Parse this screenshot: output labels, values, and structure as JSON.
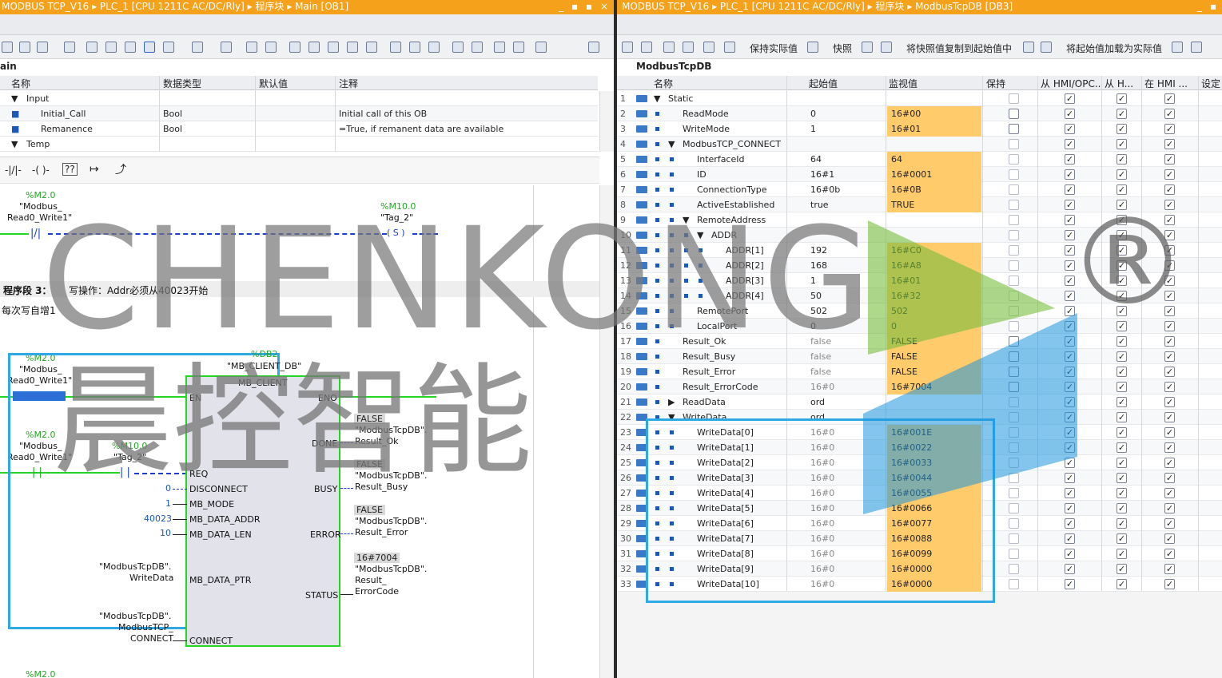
{
  "left_title": "MODBUS TCP_V16  ▸  PLC_1 [CPU 1211C AC/DC/Rly]  ▸  程序块  ▸  Main [OB1]",
  "right_title": "MODBUS TCP_V16  ▸  PLC_1 [CPU 1211C AC/DC/Rly]  ▸  程序块  ▸  ModbusTcpDB [DB3]",
  "window_controls": "_ ▪ ▪ ×",
  "interface": {
    "block_name": "ain",
    "headers": [
      "名称",
      "数据类型",
      "默认值",
      "注释"
    ],
    "rows": [
      {
        "name": "Input",
        "type": "",
        "default": "",
        "comment": ""
      },
      {
        "name": "Initial_Call",
        "type": "Bool",
        "default": "",
        "comment": "Initial call of this OB"
      },
      {
        "name": "Remanence",
        "type": "Bool",
        "default": "",
        "comment": "=True, if remanent data are available"
      },
      {
        "name": "Temp",
        "type": "",
        "default": "",
        "comment": ""
      }
    ]
  },
  "lad": {
    "net2": {
      "contact_addr": "%M2.0",
      "contact_tag1": "\"Modbus_",
      "contact_tag2": "Read0_Write1\"",
      "coil_addr": "%M10.0",
      "coil_tag": "\"Tag_2\"",
      "coil_symbol": "S"
    },
    "net3_title": "程序段 3：",
    "net3_comment": "写操作：Addr必须从40023开始",
    "net3_sub": "每次写自增1",
    "en_contact_addr": "%M2.0",
    "en_contact_tag1": "\"Modbus_",
    "en_contact_tag2": "Read0_Write1\"",
    "req_contact_addr": "%M2.0",
    "req_contact_tag1": "\"Modbus_",
    "req_contact_tag2": "Read0_Write1\"",
    "req_coil_addr": "%M10.0",
    "req_coil_tag": "\"Tag_2\"",
    "db_addr": "%DB2",
    "db_name": "\"MB_CLIENT_DB\"",
    "fb_name": "MB_CLIENT",
    "inputs": [
      "EN",
      "REQ",
      "DISCONNECT",
      "MB_MODE",
      "MB_DATA_ADDR",
      "MB_DATA_LEN",
      "MB_DATA_PTR",
      "CONNECT"
    ],
    "input_values": {
      "disconnect": "0",
      "mode": "1",
      "addr": "40023",
      "len": "10",
      "ptr1": "\"ModbusTcpDB\".",
      "ptr2": "WriteData",
      "conn1": "\"ModbusTcpDB\".",
      "conn2": "ModbusTCP_",
      "conn3": "CONNECT"
    },
    "outputs": [
      "ENO",
      "DONE",
      "BUSY",
      "ERROR",
      "STATUS"
    ],
    "output_values": [
      {
        "val": "FALSE",
        "l1": "\"ModbusTcpDB\".",
        "l2": "Result_Ok"
      },
      {
        "val": "FALSE",
        "l1": "\"ModbusTcpDB\".",
        "l2": "Result_Busy"
      },
      {
        "val": "FALSE",
        "l1": "\"ModbusTcpDB\".",
        "l2": "Result_Error"
      },
      {
        "val": "16#7004",
        "l1": "\"ModbusTcpDB\".",
        "l2": "Result_",
        "l3": "ErrorCode"
      }
    ],
    "bottom_addr": "%M2.0"
  },
  "db_toolbar": {
    "keep_actual": "保持实际值",
    "snapshot": "快照",
    "copy_snapshot": "将快照值复制到起始值中",
    "load_start": "将起始值加载为实际值"
  },
  "db": {
    "name": "ModbusTcpDB",
    "headers": [
      "名称",
      "起始值",
      "监视值",
      "保持",
      "从 HMI/OPC..",
      "从 H...",
      "在 HMI ...",
      "设定"
    ],
    "rows": [
      {
        "n": "1",
        "name": "Static",
        "start": "",
        "mon": "",
        "lvl": 0,
        "exp": "▼"
      },
      {
        "n": "2",
        "name": "ReadMode",
        "start": "0",
        "mon": "16#00",
        "lvl": 1
      },
      {
        "n": "3",
        "name": "WriteMode",
        "start": "1",
        "mon": "16#01",
        "lvl": 1
      },
      {
        "n": "4",
        "name": "ModbusTCP_CONNECT",
        "start": "",
        "mon": "",
        "lvl": 1,
        "exp": "▼"
      },
      {
        "n": "5",
        "name": "InterfaceId",
        "start": "64",
        "mon": "64",
        "lvl": 2
      },
      {
        "n": "6",
        "name": "ID",
        "start": "16#1",
        "mon": "16#0001",
        "lvl": 2
      },
      {
        "n": "7",
        "name": "ConnectionType",
        "start": "16#0b",
        "mon": "16#0B",
        "lvl": 2
      },
      {
        "n": "8",
        "name": "ActiveEstablished",
        "start": "true",
        "mon": "TRUE",
        "lvl": 2
      },
      {
        "n": "9",
        "name": "RemoteAddress",
        "start": "",
        "mon": "",
        "lvl": 2,
        "exp": "▼"
      },
      {
        "n": "10",
        "name": "ADDR",
        "start": "",
        "mon": "",
        "lvl": 3,
        "exp": "▼"
      },
      {
        "n": "11",
        "name": "ADDR[1]",
        "start": "192",
        "mon": "16#C0",
        "lvl": 4
      },
      {
        "n": "12",
        "name": "ADDR[2]",
        "start": "168",
        "mon": "16#A8",
        "lvl": 4
      },
      {
        "n": "13",
        "name": "ADDR[3]",
        "start": "1",
        "mon": "16#01",
        "lvl": 4
      },
      {
        "n": "14",
        "name": "ADDR[4]",
        "start": "50",
        "mon": "16#32",
        "lvl": 4
      },
      {
        "n": "15",
        "name": "RemotePort",
        "start": "502",
        "mon": "502",
        "lvl": 2
      },
      {
        "n": "16",
        "name": "LocalPort",
        "start": "0",
        "mon": "0",
        "lvl": 2
      },
      {
        "n": "17",
        "name": "Result_Ok",
        "start": "false",
        "mon": "FALSE",
        "lvl": 1,
        "gray": true
      },
      {
        "n": "18",
        "name": "Result_Busy",
        "start": "false",
        "mon": "FALSE",
        "lvl": 1,
        "gray": true
      },
      {
        "n": "19",
        "name": "Result_Error",
        "start": "false",
        "mon": "FALSE",
        "lvl": 1,
        "gray": true
      },
      {
        "n": "20",
        "name": "Result_ErrorCode",
        "start": "16#0",
        "mon": "16#7004",
        "lvl": 1,
        "gray": true
      },
      {
        "n": "21",
        "name": "ReadData",
        "start": "ord",
        "mon": "",
        "lvl": 1,
        "exp": "▶"
      },
      {
        "n": "22",
        "name": "WriteData",
        "start": "ord",
        "mon": "",
        "lvl": 1,
        "exp": "▼"
      },
      {
        "n": "23",
        "name": "WriteData[0]",
        "start": "16#0",
        "mon": "16#001E",
        "lvl": 2,
        "gray": true
      },
      {
        "n": "24",
        "name": "WriteData[1]",
        "start": "16#0",
        "mon": "16#0022",
        "lvl": 2,
        "gray": true
      },
      {
        "n": "25",
        "name": "WriteData[2]",
        "start": "16#0",
        "mon": "16#0033",
        "lvl": 2,
        "gray": true
      },
      {
        "n": "26",
        "name": "WriteData[3]",
        "start": "16#0",
        "mon": "16#0044",
        "lvl": 2,
        "gray": true
      },
      {
        "n": "27",
        "name": "WriteData[4]",
        "start": "16#0",
        "mon": "16#0055",
        "lvl": 2,
        "gray": true
      },
      {
        "n": "28",
        "name": "WriteData[5]",
        "start": "16#0",
        "mon": "16#0066",
        "lvl": 2,
        "gray": true
      },
      {
        "n": "29",
        "name": "WriteData[6]",
        "start": "16#0",
        "mon": "16#0077",
        "lvl": 2,
        "gray": true
      },
      {
        "n": "30",
        "name": "WriteData[7]",
        "start": "16#0",
        "mon": "16#0088",
        "lvl": 2,
        "gray": true
      },
      {
        "n": "31",
        "name": "WriteData[8]",
        "start": "16#0",
        "mon": "16#0099",
        "lvl": 2,
        "gray": true
      },
      {
        "n": "32",
        "name": "WriteData[9]",
        "start": "16#0",
        "mon": "16#0000",
        "lvl": 2,
        "gray": true
      },
      {
        "n": "33",
        "name": "WriteData[10]",
        "start": "16#0",
        "mon": "16#0000",
        "lvl": 2,
        "gray": true
      }
    ]
  },
  "watermark": {
    "latin": "CHENKONG",
    "reg": "®",
    "cn": "晨控智能"
  },
  "colors": {
    "title": "#f5a11c",
    "monitor": "#ffcb6b",
    "highlight_box": "#2ea9e6",
    "power_flow": "#22d622",
    "dashed_flow": "#1a3ccf"
  }
}
